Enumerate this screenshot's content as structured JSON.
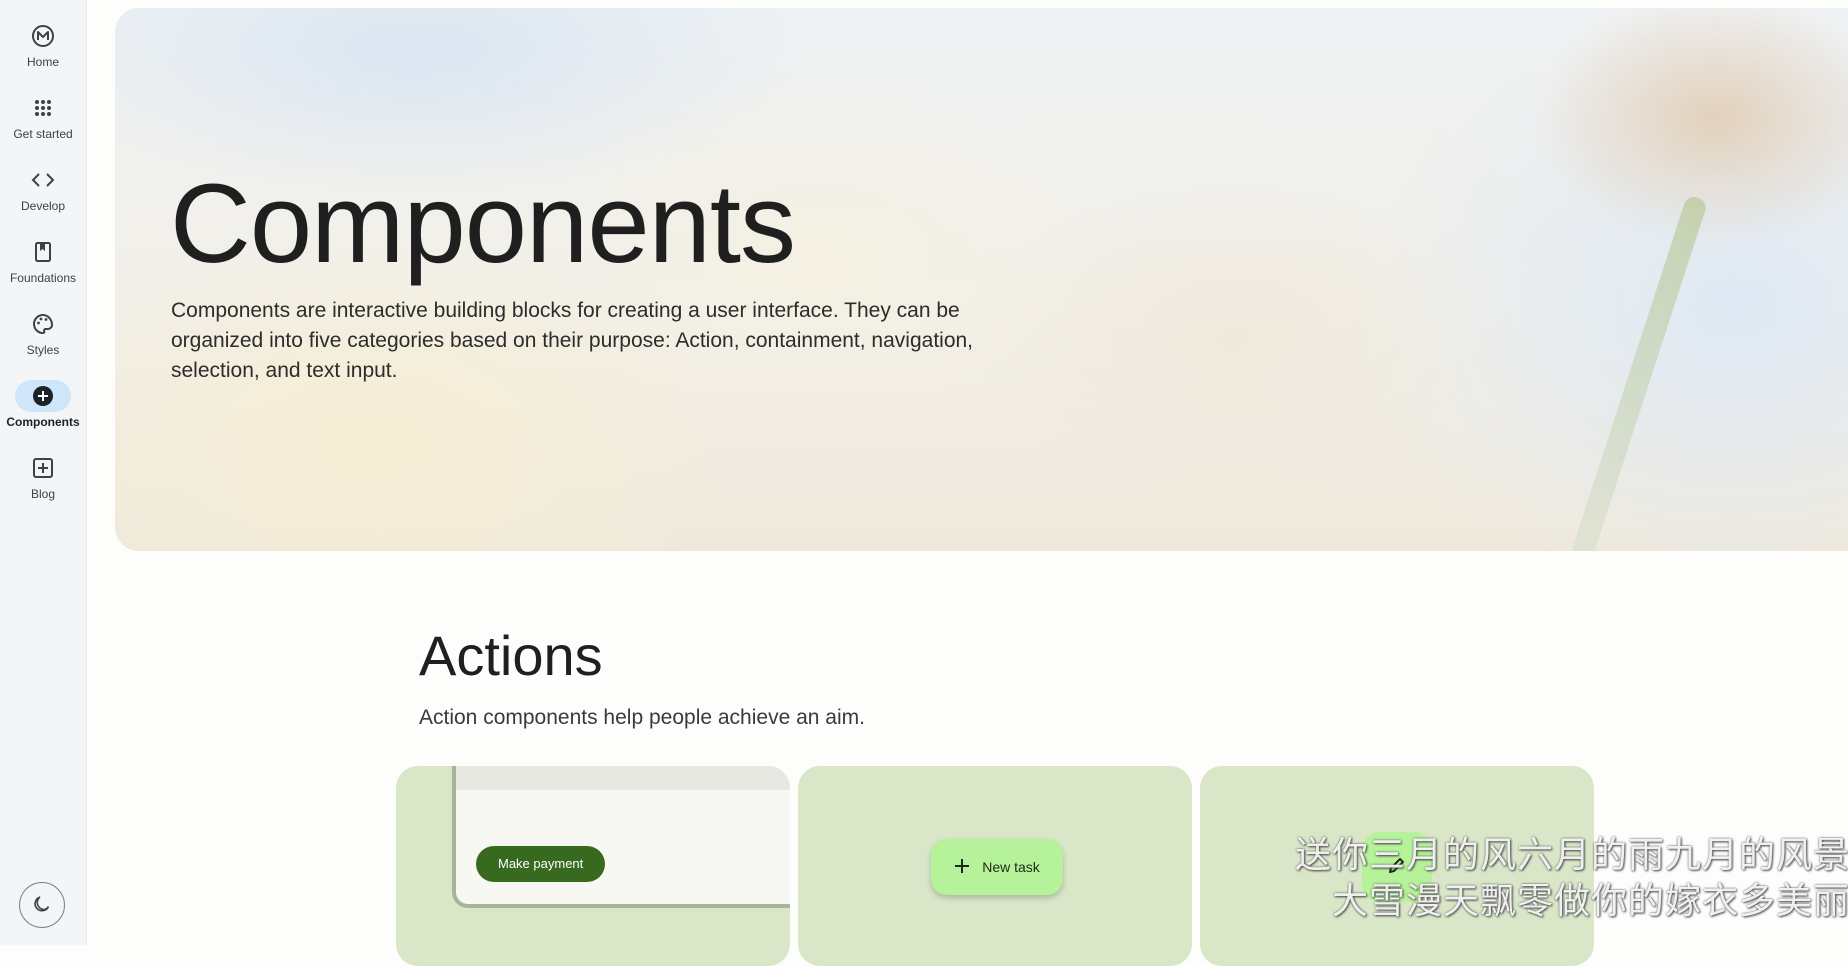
{
  "nav": {
    "items": [
      {
        "label": "Home",
        "icon": "m3-logo-icon"
      },
      {
        "label": "Get started",
        "icon": "apps-grid-icon"
      },
      {
        "label": "Develop",
        "icon": "code-icon"
      },
      {
        "label": "Foundations",
        "icon": "book-icon"
      },
      {
        "label": "Styles",
        "icon": "palette-icon"
      },
      {
        "label": "Components",
        "icon": "add-circle-icon",
        "active": true
      },
      {
        "label": "Blog",
        "icon": "add-box-icon"
      }
    ],
    "theme_toggle_icon": "moon-icon"
  },
  "hero": {
    "title": "Components",
    "description": "Components are interactive building blocks for creating a user interface. They can be organized into five categories based on their purpose: Action, containment, navigation, selection, and text input."
  },
  "actions_section": {
    "title": "Actions",
    "description": "Action components help people achieve an aim.",
    "cards": {
      "buttons_card": {
        "button_label": "Make payment"
      },
      "fab_card": {
        "button_label": "New task",
        "icon": "plus-icon"
      },
      "small_fab_card": {
        "icon": "pencil-icon"
      }
    }
  },
  "watermark": {
    "line1": "送你三月的风六月的雨九月的风景",
    "line2": "大雪漫天飘零做你的嫁衣多美丽"
  },
  "colors": {
    "accent": "#376a1e",
    "fab": "#b6f29a",
    "card_bg": "#d9e6c8",
    "nav_active": "#cfe6fa"
  }
}
